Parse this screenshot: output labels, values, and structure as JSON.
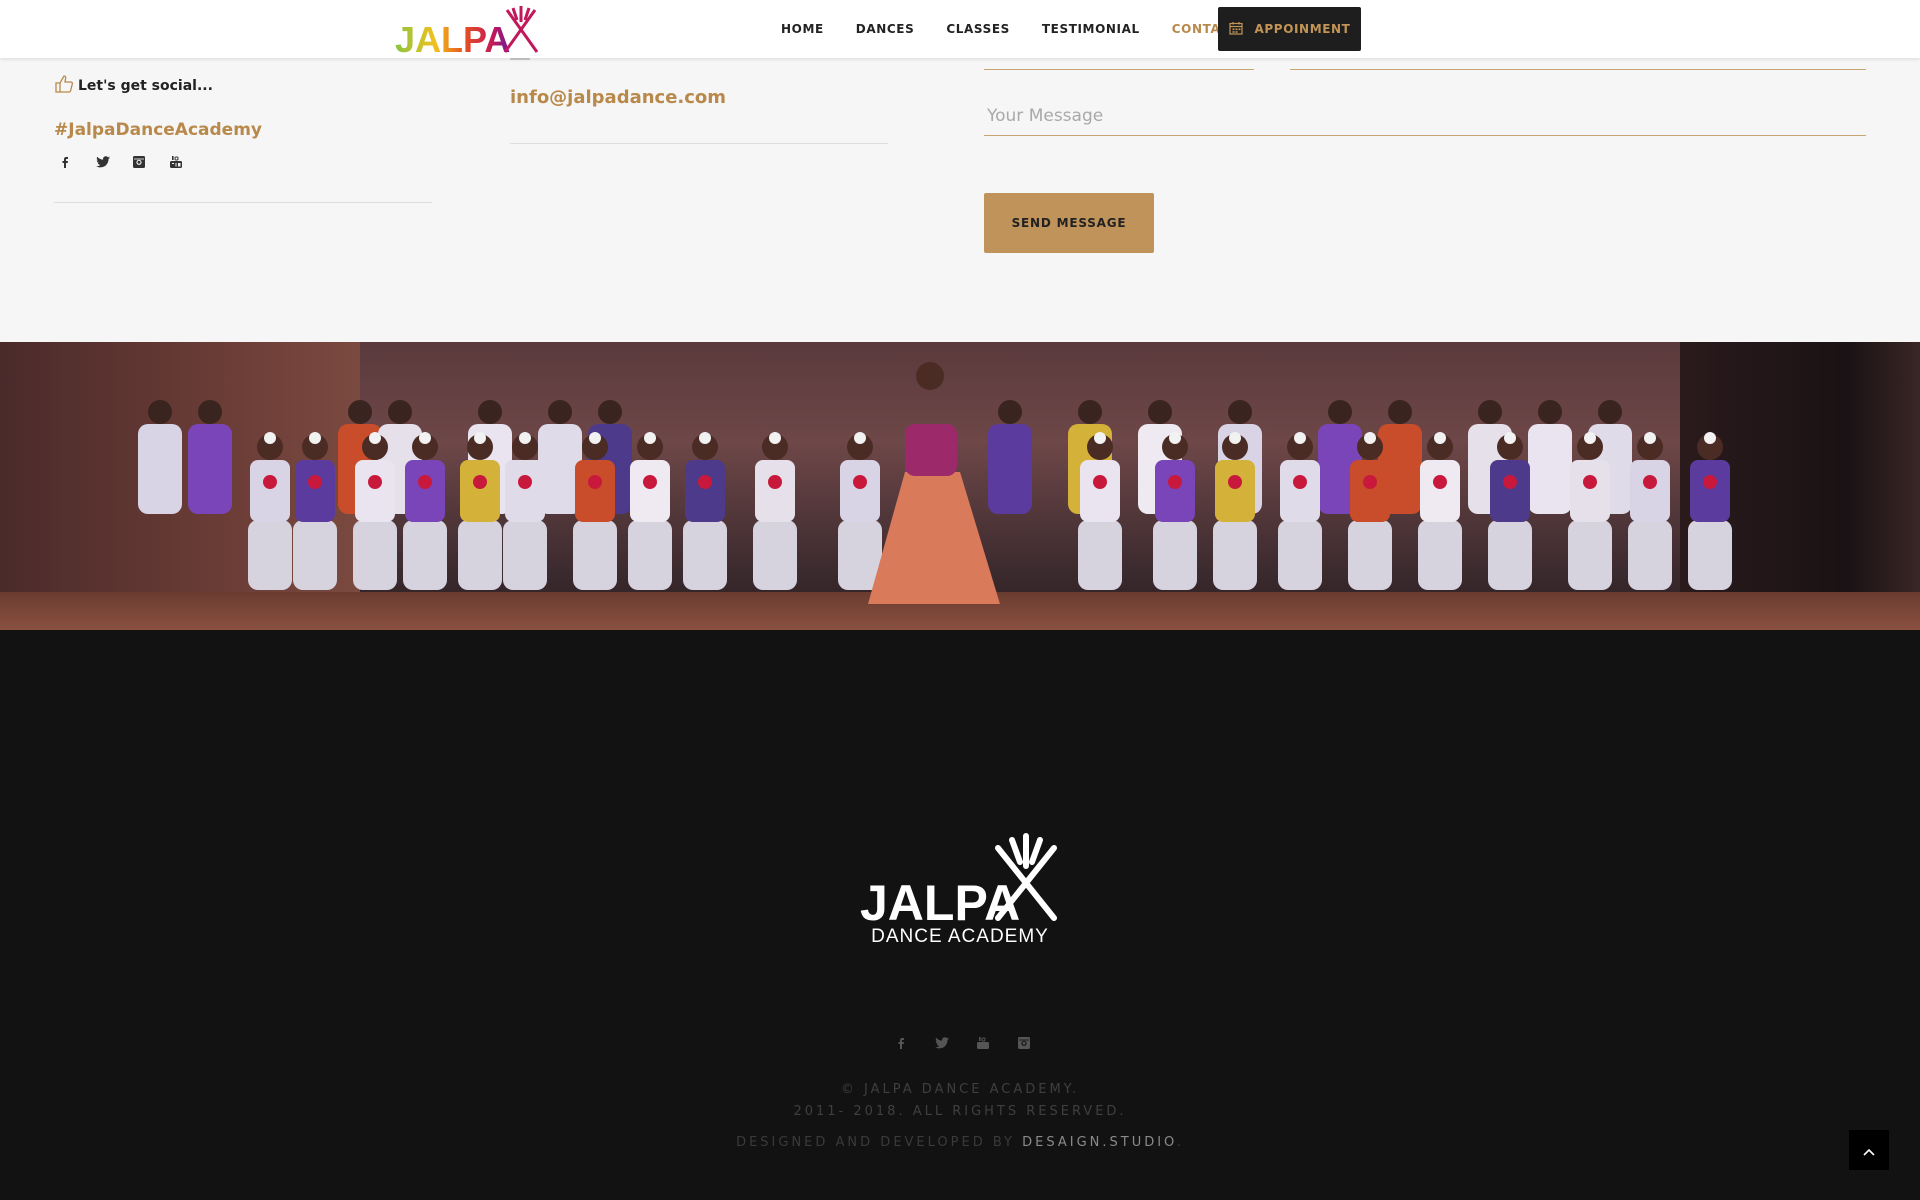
{
  "header": {
    "logo_text": "JALPA",
    "nav": [
      {
        "label": "HOME"
      },
      {
        "label": "DANCES"
      },
      {
        "label": "CLASSES"
      },
      {
        "label": "TESTIMONIAL"
      },
      {
        "label": "CONTACT",
        "active": true
      }
    ],
    "appointment_label": "APPOINMENT",
    "appointment_icon": "calendar-icon"
  },
  "contact": {
    "social_heading": "Let's get social...",
    "social_heading_icon": "thumbs-up-icon",
    "hashtag": "#JalpaDanceAcademy",
    "social_icons": [
      "facebook-icon",
      "twitter-icon",
      "instagram-icon",
      "youtube-icon"
    ],
    "email": "info@jalpadance.com",
    "message_placeholder": "Your Message",
    "send_label": "SEND MESSAGE"
  },
  "footer": {
    "logo_text": "JALPA",
    "logo_subtitle": "DANCE ACADEMY",
    "social_icons": [
      "facebook-icon",
      "twitter-icon",
      "youtube-icon",
      "instagram-icon"
    ],
    "copyright_line1": "© JALPA DANCE ACADEMY.",
    "copyright_line2": "2011- 2018. ALL RIGHTS RESERVED.",
    "credit_prefix": "DESIGNED AND DEVELOPED BY ",
    "credit_link": "DESAIGN.STUDIO",
    "credit_suffix": ".",
    "back_to_top_icon": "chevron-up-icon"
  },
  "colors": {
    "accent": "#b8894a",
    "button": "#bf935a",
    "footer_bg": "#121212",
    "appointment_bg": "#1e1e1e"
  }
}
